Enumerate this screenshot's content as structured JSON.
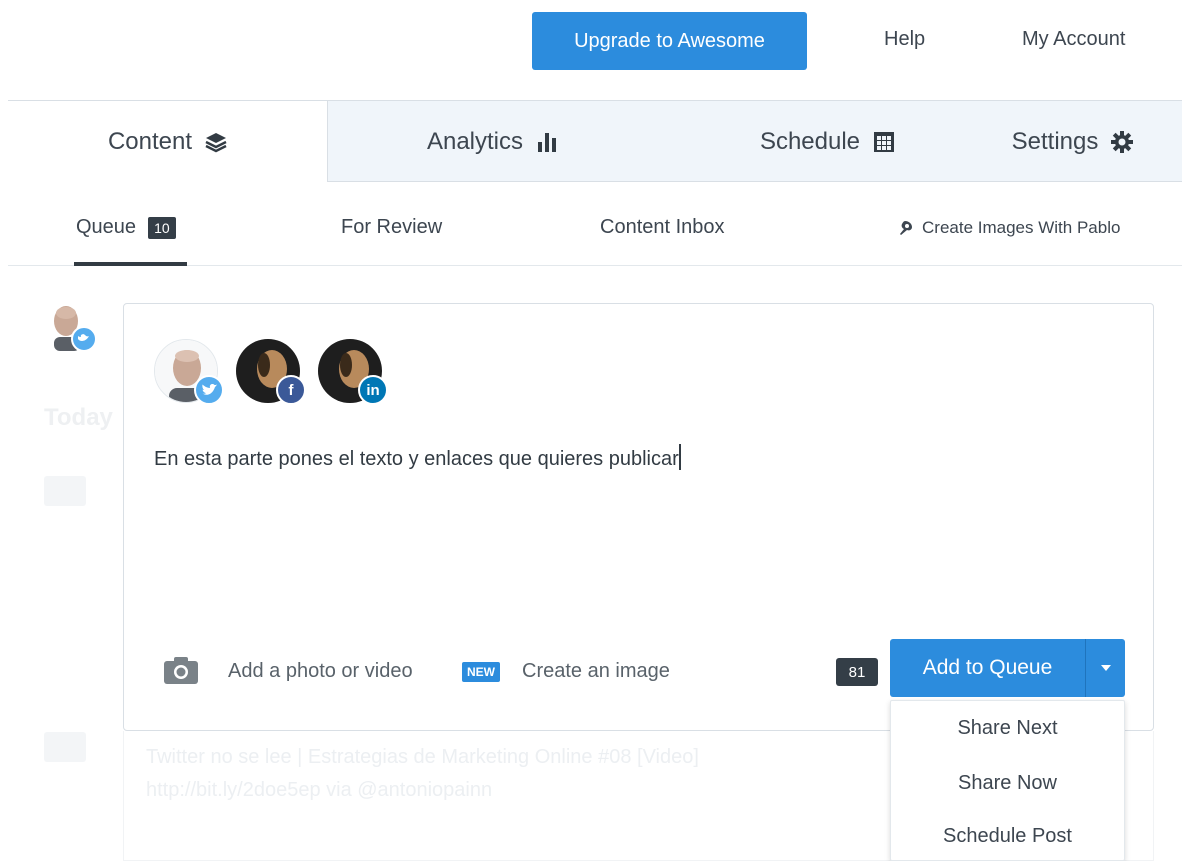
{
  "topbar": {
    "upgrade_label": "Upgrade to Awesome",
    "help_label": "Help",
    "account_label": "My Account"
  },
  "main_tabs": [
    {
      "label": "Content",
      "icon": "layers-icon"
    },
    {
      "label": "Analytics",
      "icon": "bar-chart-icon"
    },
    {
      "label": "Schedule",
      "icon": "calendar-icon"
    },
    {
      "label": "Settings",
      "icon": "gear-icon"
    }
  ],
  "sub_tabs": {
    "queue_label": "Queue",
    "queue_count": "10",
    "review_label": "For Review",
    "inbox_label": "Content Inbox",
    "pablo_label": "Create Images With Pablo"
  },
  "sidebar": {
    "today_label": "Today"
  },
  "composer": {
    "profiles": [
      {
        "network": "twitter",
        "badge": "twitter-icon"
      },
      {
        "network": "facebook",
        "badge": "facebook-icon"
      },
      {
        "network": "linkedin",
        "badge": "linkedin-icon"
      }
    ],
    "text": "En esta parte pones el texto y enlaces que quieres publicar",
    "add_media_label": "Add a photo or video",
    "new_badge": "NEW",
    "create_image_label": "Create an image",
    "char_count": "81",
    "add_to_queue_label": "Add to Queue"
  },
  "faded_post": {
    "line1": "Twitter no se lee | Estrategias de Marketing Online #08 [Video]",
    "line2": "http://bit.ly/2doe5ep via @antoniopainn"
  },
  "dropdown": {
    "items": [
      "Share Next",
      "Share Now",
      "Schedule Post"
    ]
  },
  "colors": {
    "primary": "#2c8cdd",
    "dark_badge": "#343e47",
    "tab_inactive_bg": "#f0f5fa"
  }
}
